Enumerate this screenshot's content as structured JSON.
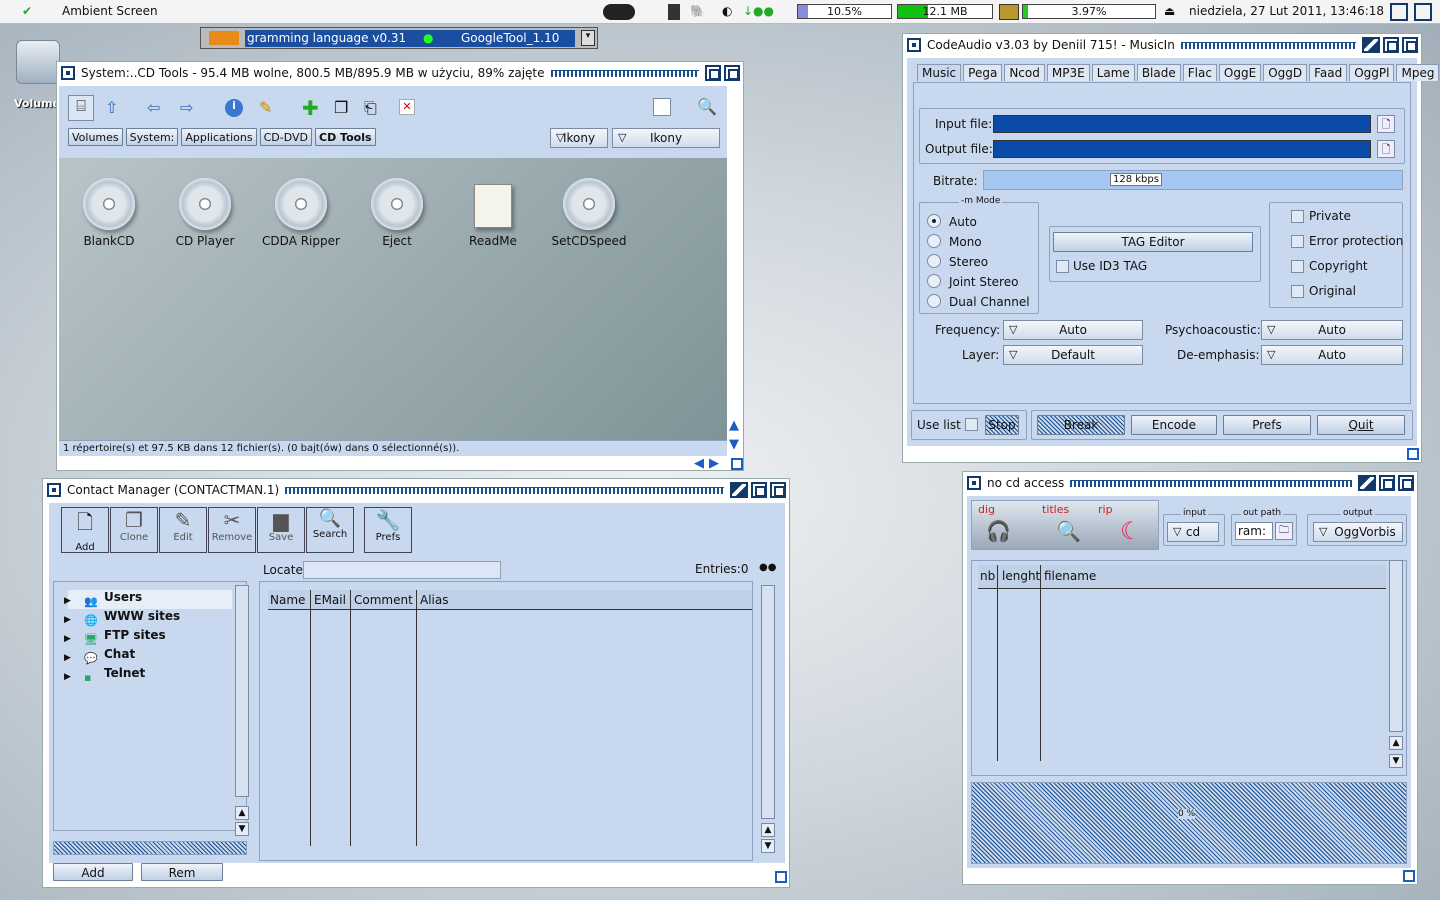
{
  "topbar": {
    "title": "Ambient Screen",
    "mem_label": "12.1 MB",
    "cpu1": "10.5%",
    "cpu2": "3.97%",
    "clock": "niedziela, 27 Lut 2011, 13:46:18"
  },
  "dock": {
    "program_field": "gramming language v0.31",
    "program_field2": "GoogleTool_1.10"
  },
  "desktop": {
    "icon_label": "Volume"
  },
  "system_win": {
    "title": "System:..CD Tools - 95.4 MB wolne, 800.5 MB/895.9 MB w użyciu, 89% zajęte",
    "paths": [
      "Volumes",
      "System:",
      "Applications",
      "CD-DVD",
      "CD Tools"
    ],
    "view1": "Ikony",
    "view2": "Ikony",
    "icons": [
      "BlankCD",
      "CD Player",
      "CDDA Ripper",
      "Eject",
      "ReadMe",
      "SetCDSpeed"
    ],
    "status": "1 répertoire(s) et 97.5 KB dans 12 fichier(s). (0 bajt(ów) dans 0 sélectionné(s))."
  },
  "contact_win": {
    "title": "Contact Manager (CONTACTMAN.1)",
    "toolbar": [
      "Add",
      "Clone",
      "Edit",
      "Remove",
      "Save",
      "Search",
      "Prefs"
    ],
    "tree": [
      "Users",
      "WWW sites",
      "FTP sites",
      "Chat",
      "Telnet"
    ],
    "locate_label": "Locate",
    "entries": "Entries:0",
    "columns": [
      "Name",
      "EMail",
      "Comment",
      "Alias"
    ],
    "add": "Add",
    "rem": "Rem"
  },
  "codeaudio_win": {
    "title": "CodeAudio v3.03 by Deniil 715! - MusicIn",
    "tabs": [
      "Music",
      "Pega",
      "Ncod",
      "MP3E",
      "Lame",
      "Blade",
      "Flac",
      "OggE",
      "OggD",
      "Faad",
      "OggPl",
      "Mpeg"
    ],
    "input_label": "Input file:",
    "output_label": "Output file:",
    "bitrate_label": "Bitrate:",
    "bitrate": "128 kbps",
    "mode_title": "-m Mode",
    "modes": [
      "Auto",
      "Mono",
      "Stereo",
      "Joint Stereo",
      "Dual Channel"
    ],
    "tag_editor": "TAG Editor",
    "use_id3": "Use ID3 TAG",
    "flags": [
      "Private",
      "Error protection",
      "Copyright",
      "Original"
    ],
    "frequency_label": "Frequency:",
    "frequency": "Auto",
    "layer_label": "Layer:",
    "layer": "Default",
    "psycho_label": "Psychoacoustic:",
    "psycho": "Auto",
    "deemph_label": "De-emphasis:",
    "deemph": "Auto",
    "use_list": "Use list",
    "stop": "Stop",
    "break": "Break",
    "encode": "Encode",
    "prefs": "Prefs",
    "quit": "Quit"
  },
  "nocd_win": {
    "title": "no cd access",
    "tabs": [
      "dig",
      "titles",
      "rip"
    ],
    "input_title": "input",
    "input": "cd",
    "outpath_title": "out path",
    "outpath": "ram:",
    "output_title": "output",
    "output": "OggVorbis",
    "columns": [
      "nb",
      "lenght",
      "filename"
    ],
    "progress": "0 %"
  }
}
